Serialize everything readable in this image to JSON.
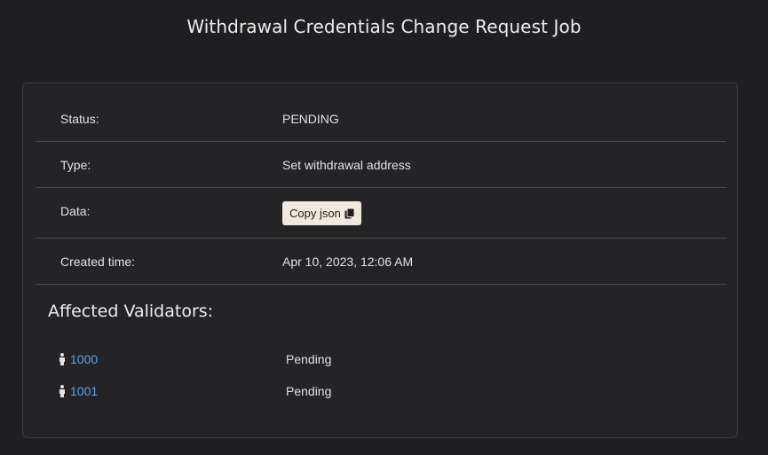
{
  "page": {
    "title": "Withdrawal Credentials Change Request Job"
  },
  "details": {
    "status": {
      "label": "Status:",
      "value": "PENDING"
    },
    "type": {
      "label": "Type:",
      "value": "Set withdrawal address"
    },
    "data": {
      "label": "Data:",
      "button_label": "Copy json",
      "button_icon": "copy-icon"
    },
    "created": {
      "label": "Created time:",
      "value": "Apr 10, 2023, 12:06 AM"
    }
  },
  "validators": {
    "title": "Affected Validators:",
    "items": [
      {
        "id": "1000",
        "status": "Pending",
        "icon": "person-icon"
      },
      {
        "id": "1001",
        "status": "Pending",
        "icon": "person-icon"
      }
    ]
  },
  "colors": {
    "background": "#1f1e20",
    "card": "#242326",
    "link": "#5aa5ee",
    "button": "#efe9df"
  }
}
